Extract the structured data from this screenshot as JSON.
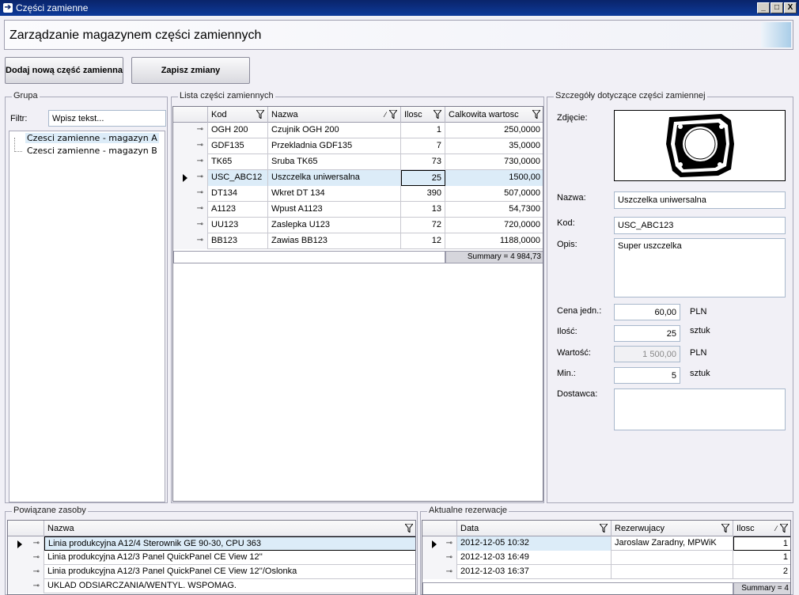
{
  "window": {
    "title": "Części zamienne",
    "icon": "arrow-right-icon",
    "controls": {
      "minimize": "_",
      "maximize": "□",
      "close": "X"
    }
  },
  "header": {
    "title": "Zarządzanie magazynem części zamiennych"
  },
  "toolbar": {
    "add_label": "Dodaj nową część zamienna",
    "save_label": "Zapisz zmiany"
  },
  "group_panel": {
    "legend": "Grupa",
    "filter_label": "Filtr:",
    "filter_value": "Wpisz tekst...",
    "items": [
      {
        "label": "Czesci zamienne - magazyn A",
        "selected": true
      },
      {
        "label": "Czesci zamienne - magazyn B",
        "selected": false
      }
    ]
  },
  "parts_list": {
    "legend": "Lista części zamiennych",
    "columns": [
      "Kod",
      "Nazwa",
      "Ilosc",
      "Calkowita wartosc"
    ],
    "rows": [
      {
        "kod": "OGH 200",
        "nazwa": "Czujnik OGH 200",
        "ilosc": "1",
        "wartosc": "250,0000"
      },
      {
        "kod": "GDF135",
        "nazwa": "Przekladnia GDF135",
        "ilosc": "7",
        "wartosc": "35,0000"
      },
      {
        "kod": "TK65",
        "nazwa": "Sruba TK65",
        "ilosc": "73",
        "wartosc": "730,0000"
      },
      {
        "kod": "USC_ABC12",
        "nazwa": "Uszczelka uniwersalna",
        "ilosc": "25",
        "wartosc": "1500,00"
      },
      {
        "kod": "DT134",
        "nazwa": "Wkret DT 134",
        "ilosc": "390",
        "wartosc": "507,0000"
      },
      {
        "kod": "A1123",
        "nazwa": "Wpust A1123",
        "ilosc": "13",
        "wartosc": "54,7300"
      },
      {
        "kod": "UU123",
        "nazwa": "Zaslepka U123",
        "ilosc": "72",
        "wartosc": "720,0000"
      },
      {
        "kod": "BB123",
        "nazwa": "Zawias BB123",
        "ilosc": "12",
        "wartosc": "1188,0000"
      }
    ],
    "selected_index": 3,
    "summary": "Summary = 4 984,73"
  },
  "details": {
    "legend": "Szczegóły dotyczące części zamiennej",
    "photo_label": "Zdjęcie:",
    "name_label": "Nazwa:",
    "name_value": "Uszczelka uniwersalna",
    "code_label": "Kod:",
    "code_value": "USC_ABC123",
    "desc_label": "Opis:",
    "desc_value": "Super uszczelka",
    "price_label": "Cena jedn.:",
    "price_value": "60,00",
    "price_unit": "PLN",
    "qty_label": "Ilość:",
    "qty_value": "25",
    "qty_unit": "sztuk",
    "value_label": "Wartość:",
    "value_value": "1 500,00",
    "value_unit": "PLN",
    "min_label": "Min.:",
    "min_value": "5",
    "min_unit": "sztuk",
    "supplier_label": "Dostawca:",
    "supplier_value": ""
  },
  "resources": {
    "legend": "Powiązane zasoby",
    "column": "Nazwa",
    "rows": [
      "Linia produkcyjna A12/4 Sterownik GE 90-30, CPU 363",
      "Linia produkcyjna A12/3 Panel QuickPanel CE View 12''",
      "Linia produkcyjna A12/3 Panel QuickPanel CE View 12''/Oslonka",
      "UKLAD ODSIARCZANIA/WENTYL. WSPOMAG."
    ]
  },
  "reservations": {
    "legend": "Aktualne rezerwacje",
    "columns": [
      "Data",
      "Rezerwujacy",
      "Ilosc"
    ],
    "rows": [
      {
        "data": "2012-12-05 10:32",
        "rez": "Jaroslaw Zaradny, MPWiK",
        "ilosc": "1"
      },
      {
        "data": "2012-12-03 16:49",
        "rez": "",
        "ilosc": "1"
      },
      {
        "data": "2012-12-03 16:37",
        "rez": "",
        "ilosc": "2"
      }
    ],
    "summary": "Summary = 4"
  }
}
